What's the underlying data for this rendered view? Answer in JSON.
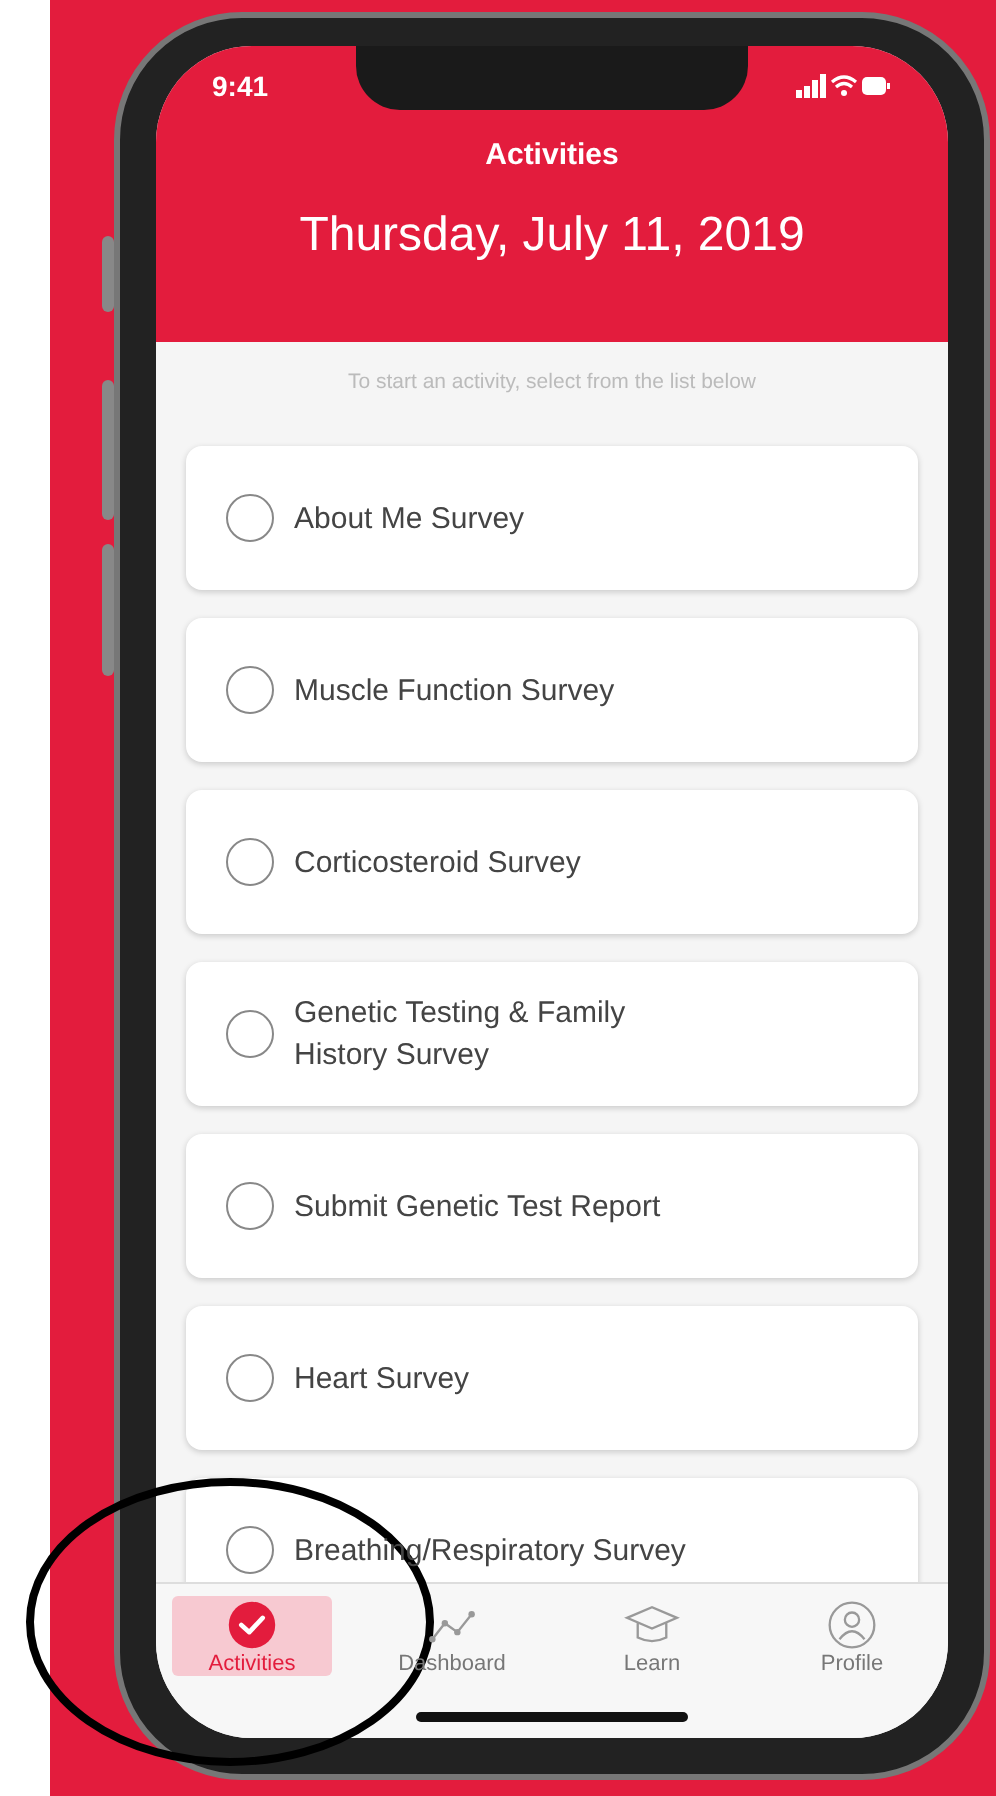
{
  "status_bar": {
    "time": "9:41"
  },
  "header": {
    "title": "Activities",
    "date": "Thursday, July 11, 2019"
  },
  "hint": "To start an activity, select from the list below",
  "activities": [
    {
      "label": "About Me Survey",
      "checked": false
    },
    {
      "label": "Muscle Function Survey",
      "checked": false
    },
    {
      "label": "Corticosteroid Survey",
      "checked": false
    },
    {
      "label": "Genetic Testing & Family History Survey",
      "checked": false
    },
    {
      "label": "Submit Genetic Test Report",
      "checked": false
    },
    {
      "label": "Heart Survey",
      "checked": false
    },
    {
      "label": "Breathing/Respiratory Survey",
      "checked": false
    }
  ],
  "tabs": [
    {
      "label": "Activities",
      "kind": "check",
      "selected": true
    },
    {
      "label": "Dashboard",
      "kind": "chart",
      "selected": false
    },
    {
      "label": "Learn",
      "kind": "cap",
      "selected": false
    },
    {
      "label": "Profile",
      "kind": "person",
      "selected": false
    }
  ]
}
